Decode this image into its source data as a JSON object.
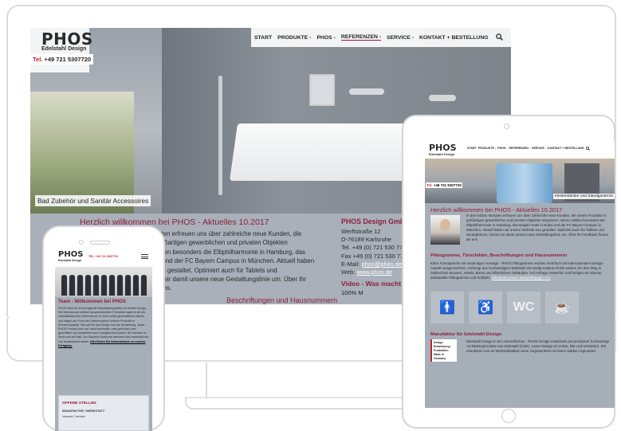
{
  "desktop": {
    "logo": {
      "brand": "PHOS",
      "tagline": "Edelstahl Design"
    },
    "phone": {
      "prefix": "Tel.",
      "number": "+49 721 5307720"
    },
    "nav": [
      "START",
      "PRODUKTE -",
      "PHOS -",
      "REFERENZEN -",
      "SERVICE -",
      "KONTAKT + BESTELLUNG"
    ],
    "hero_caption": "Bad Zubehör und Sanitär Accessoires",
    "welcome": {
      "title": "Herzlich willkommen bei PHOS - Aktuelles 10.2017",
      "lines": [
        "letzten Monaten erfreuen uns über zahlreiche neue Kunden, die",
        "rodukte in großartigen gewerblichen und privaten Objekten",
        "n. Hierzu zählen besonders die Elbphilharmonie in Hamburg, das",
        "otel in Dubai und der FC Bayern Campus in München. Aktuell haben",
        "e Website neu gestaltet. Optimiert auch für Tablets und",
        "ones, setzen wir damit unsere neue Gestaltungslinie um. Über Ihr",
        "k freuen wir uns."
      ],
      "next_heading": "Beschriftungen und Hausnummern"
    },
    "contact": {
      "title": "PHOS Design GmbH",
      "lines": [
        "Werftstraße 12",
        "D-76189 Karlsruhe",
        "Tel. +49 (0) 721 530 77",
        "Fax +49 (0) 721 530 77"
      ],
      "email_label": "E-Mail:",
      "email": "phos@phos.de",
      "web_label": "Web:",
      "web": "www.phos.de"
    },
    "video": {
      "title": "Video - Was macht P",
      "zoom": "100% M"
    }
  },
  "tablet": {
    "logo": {
      "brand": "PHOS",
      "tagline": "Edelstahl Design"
    },
    "nav": [
      "START",
      "PRODUKTE -",
      "PHOS -",
      "REFERENZEN -",
      "SERVICE -",
      "KONTAKT + BESTELLUNG"
    ],
    "phone": {
      "prefix": "Tel.",
      "number": "+49 721 5307720"
    },
    "hero_caption": "Kleiderständer und Standgarderob",
    "title": "Herzlich willkommen bei PHOS - Aktuelles 10.2017",
    "text": "In den letzten Monaten erfreuen uns über zahlreiche neue Kunden, die unsere Produkte in großartigen gewerblichen und privaten Objekten integrieren. Hierzu zählen besonders die Elbphilharmonie in Hamburg, das Bulgari Hotel in Dubai und der FC Bayern Campus in München. Aktuell haben wir unsere Website neu gestaltet. Optimiert auch für Tablets und Smartphones, setzen wir damit unsere neue Gestaltungslinie um. Über Ihr Feedback freuen wir uns.",
    "section2": {
      "title": "Piktogramme, Türschilder, Beschriftungen und Hausnummern",
      "text": "Klare Formsprache mit eindeutiger Aussage - PHOS Piktogramme wurden mehrfach mit internationalen Design-Awards ausgezeichnet. Gefertigt aus hochwertigem Edelstahl mit seidig-mattem Finish weisen Sie den Weg in zahlreichen Museen, Hotels, Büros und öffentlichen Gebäuden. Auf Anfrage entwerfen und fertigen wir ebenso individuelle Piktogramme und Schilder.",
      "link": "Übersicht unserer Beschriftungen >>>"
    },
    "icons": [
      {
        "name": "restroom-pictogram-icon",
        "glyph": "🚹"
      },
      {
        "name": "accessible-pictogram-icon",
        "glyph": "♿"
      },
      {
        "name": "wc-pictogram-icon",
        "glyph": "WC"
      },
      {
        "name": "coffee-cup-pictogram-icon",
        "glyph": "☕"
      }
    ],
    "section3": {
      "title": "Manufaktur für Edelstahl-Design",
      "badge": [
        "Design",
        "Entwicklung",
        "Produktion",
        "Made in Germany"
      ],
      "text": "Edelstahl Design in der mineralischen - PHOS Design entwickelt und produziert hochwertige Architekturprodukte aus Edelstahl (CNS). Unser Design ist zeitlos, klar und einheitlich. Wir orientieren uns an Wertmaßstäben einer Gegebenheit mit einem starken regionalen"
    }
  },
  "phone": {
    "logo": {
      "brand": "PHOS",
      "tagline": "Edelstahl Design"
    },
    "tel": "TEL. +49 721 5307720",
    "title": "Team - Willkommen bei PHOS",
    "text": "PHOS steht für hervorragende Manufakturqualität und bestes Design. Wir international vielfach ausgezeichneten Produkten agieren wir als mittelständisches Unternehmen in einer selbst geschaffenen Nische und tragen als Firma den Markennamen unserer Produkte in Premiumqualität. Dies gilt für das Design und die Herstellung. Jedes PHOS Produkt wird von Hand bearbeitet, matt gebürstet oder geschliffen und wahlweise auch hochglanzend poliert. Wir arbeiten in Serie und auf Maß. Am Standort Karlsruhe wachsen und entwickeln wir uns kontinuierlich weiter.",
    "link": "Hier finden Sie Informationen zu unserer Fertigung.",
    "box": {
      "title": "OFFENE STELLEN",
      "line1": "MANUFAKTUR / WERKSTATT",
      "line2": "Versand / Vertrieb"
    }
  }
}
